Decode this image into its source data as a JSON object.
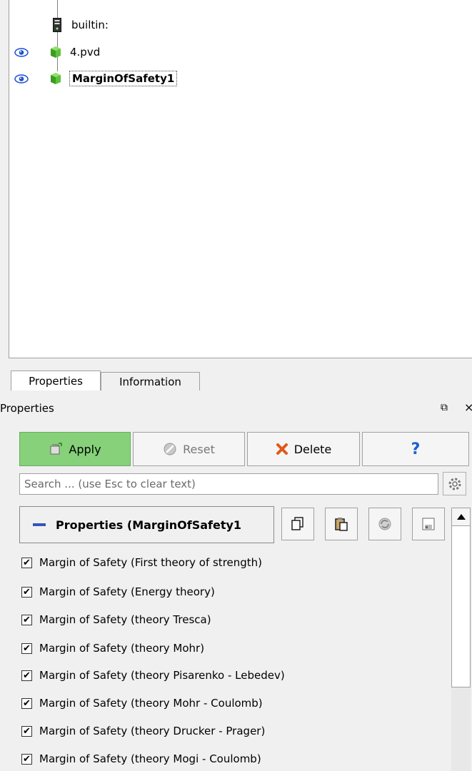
{
  "pipeline": {
    "items": [
      {
        "label": "builtin:"
      },
      {
        "label": "4.pvd"
      },
      {
        "label": "MarginOfSafety1"
      }
    ]
  },
  "tabs": [
    {
      "label": "Properties"
    },
    {
      "label": "Information"
    }
  ],
  "panel": {
    "title": "Properties",
    "float_icon": "⧉",
    "close_icon": "×"
  },
  "toolbar": {
    "apply_label": "Apply",
    "reset_label": "Reset",
    "delete_label": "Delete",
    "help_label": "?"
  },
  "search": {
    "placeholder": "Search ... (use Esc to clear text)"
  },
  "section": {
    "title": "Properties (MarginOfSafety1"
  },
  "checks": [
    {
      "label": "Margin of Safety (First theory of strength)",
      "checked": true
    },
    {
      "label": "Margin of Safety (Energy theory)",
      "checked": true
    },
    {
      "label": "Margin of Safety (theory Tresca)",
      "checked": true
    },
    {
      "label": "Margin of Safety (theory Mohr)",
      "checked": true
    },
    {
      "label": "Margin of Safety (theory Pisarenko - Lebedev)",
      "checked": true
    },
    {
      "label": "Margin of Safety (theory Mohr - Coulomb)",
      "checked": true
    },
    {
      "label": "Margin of Safety (theory Drucker - Prager)",
      "checked": true
    },
    {
      "label": "Margin of Safety (theory Mogi - Coulomb)",
      "checked": true
    }
  ],
  "colors": {
    "apply_bg": "#86d17a",
    "cube_green": "#4caf2c",
    "eye_blue": "#1a4fd6",
    "help_blue": "#1f5fd0",
    "delete_orange": "#e05a1a"
  }
}
